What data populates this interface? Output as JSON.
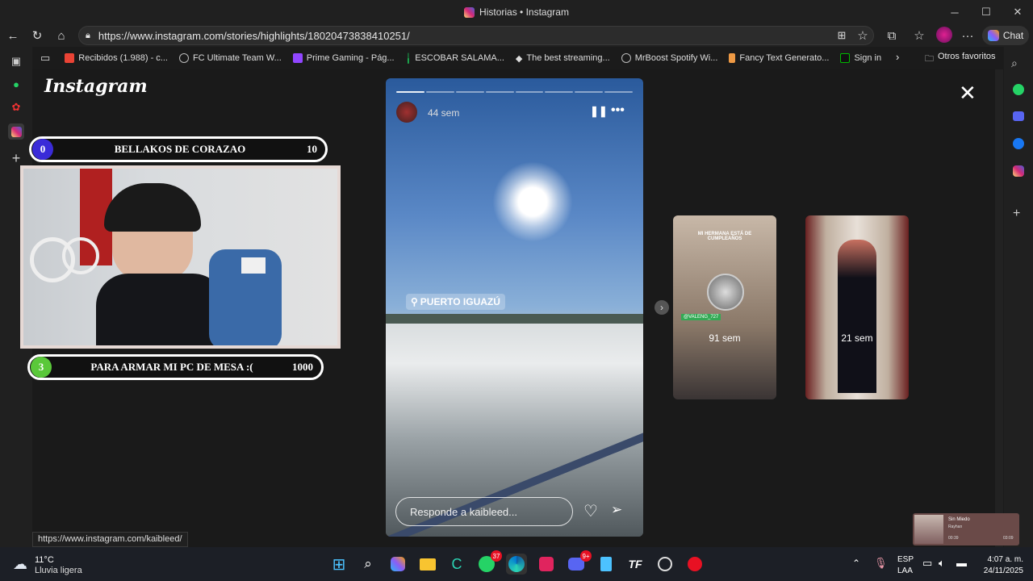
{
  "window": {
    "title": "Historias • Instagram",
    "controls": [
      "─",
      "☐",
      "✕"
    ]
  },
  "address": {
    "url": "https://www.instagram.com/stories/highlights/18020473838410251/"
  },
  "copilot": {
    "label": "Chat"
  },
  "bookmarks": [
    {
      "label": "Recibidos (1.988) - c...",
      "color": "#ea4335"
    },
    {
      "label": "FC Ultimate Team W...",
      "color": "#888"
    },
    {
      "label": "Prime Gaming - Pág...",
      "color": "#9146ff"
    },
    {
      "label": "ESCOBAR SALAMA...",
      "color": "#1db954"
    },
    {
      "label": "The best streaming...",
      "color": "#fff"
    },
    {
      "label": "MrBoost Spotify Wi...",
      "color": "#888"
    },
    {
      "label": "Fancy Text Generato...",
      "color": "#e94"
    },
    {
      "label": "Sign in",
      "color": "#0b0"
    }
  ],
  "other_favorites": "Otros favoritos",
  "instagram": {
    "logo": "Instagram",
    "close": "✕"
  },
  "overlay": {
    "goal1": {
      "num": "0",
      "label": "BELLAKOS DE CORAZAO",
      "value": "10",
      "color": "#3a2bd8"
    },
    "goal2": {
      "num": "3",
      "label": "PARA ARMAR MI PC DE MESA :(",
      "value": "1000",
      "color": "#5ac83a"
    }
  },
  "story": {
    "time": "44 sem",
    "location": "PUERTO IGUAZÚ",
    "reply_placeholder": "Responde a kaibleed...",
    "segments": 8
  },
  "thumbs": [
    {
      "time": "91 sem",
      "caption": "MI HERMANA ESTÁ DE CUMPLEAÑOS",
      "tag": "@VALENG_727"
    },
    {
      "time": "21 sem"
    }
  ],
  "status_url": "https://www.instagram.com/kaibleed/",
  "media": {
    "title": "Sin Miedo",
    "artist": "Rayhan",
    "t_start": "00:39",
    "t_end": "03:09"
  },
  "weather": {
    "temp": "11°C",
    "desc": "Lluvia ligera"
  },
  "tray": {
    "lang1": "ESP",
    "lang2": "LAA",
    "time": "4:07 a. m.",
    "date": "24/11/2025"
  },
  "badges": {
    "whatsapp": "37",
    "discord": "9+"
  }
}
